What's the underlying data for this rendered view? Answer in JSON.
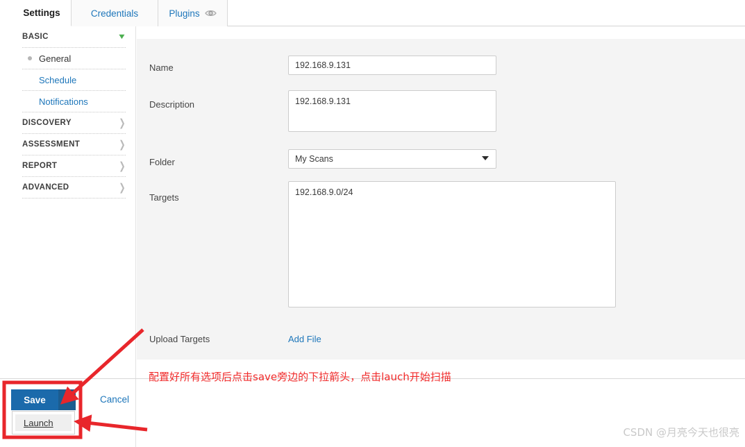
{
  "tabs": [
    {
      "id": "settings",
      "label": "Settings",
      "active": true,
      "icon": null
    },
    {
      "id": "credentials",
      "label": "Credentials",
      "active": false,
      "icon": null
    },
    {
      "id": "plugins",
      "label": "Plugins",
      "active": false,
      "icon": "eye-icon"
    }
  ],
  "sidebar": {
    "groups": [
      {
        "label": "BASIC",
        "expanded": true,
        "chevron": "chevron-down-icon",
        "items": [
          {
            "label": "General",
            "current": true
          },
          {
            "label": "Schedule",
            "current": false
          },
          {
            "label": "Notifications",
            "current": false
          }
        ]
      },
      {
        "label": "DISCOVERY",
        "expanded": false,
        "chevron": "chevron-right-icon",
        "items": []
      },
      {
        "label": "ASSESSMENT",
        "expanded": false,
        "chevron": "chevron-right-icon",
        "items": []
      },
      {
        "label": "REPORT",
        "expanded": false,
        "chevron": "chevron-right-icon",
        "items": []
      },
      {
        "label": "ADVANCED",
        "expanded": false,
        "chevron": "chevron-right-icon",
        "items": []
      }
    ]
  },
  "form": {
    "name": {
      "label": "Name",
      "value": "192.168.9.131",
      "placeholder": ""
    },
    "description": {
      "label": "Description",
      "value": "192.168.9.131",
      "placeholder": ""
    },
    "folder": {
      "label": "Folder",
      "value": "My Scans",
      "options": [
        "My Scans"
      ],
      "caret": "chevron-down-icon"
    },
    "targets": {
      "label": "Targets",
      "value": "192.168.9.0/24",
      "placeholder": ""
    },
    "upload_targets": {
      "label": "Upload Targets",
      "add_file_label": "Add File"
    }
  },
  "footer": {
    "save_label": "Save",
    "save_caret": "chevron-down-icon",
    "launch_label": "Launch",
    "cancel_label": "Cancel"
  },
  "annotations": {
    "note": "配置好所有选项后点击save旁边的下拉箭头，点击lauch开始扫描",
    "color": "#f02a2a",
    "arrow_count": 2,
    "highlight_box": "red-rectangle-around-save-and-launch"
  },
  "watermark": {
    "text": "CSDN @月亮今天也很亮"
  },
  "colors": {
    "accent_blue": "#1d76ba",
    "save_blue": "#1b6aab",
    "save_caret_blue": "#1c5d90",
    "panel_gray": "#f4f4f4",
    "annotation_red": "#f02a2a",
    "expanded_chevron_green": "#4caf50"
  }
}
